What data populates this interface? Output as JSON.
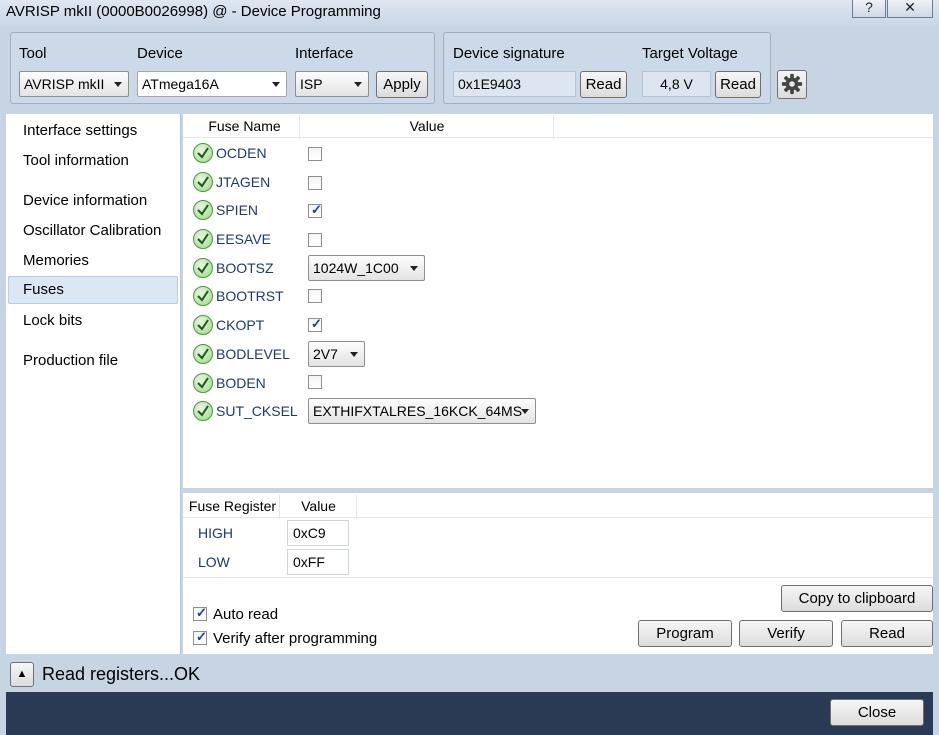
{
  "window": {
    "title": "AVRISP mkII (0000B0026998) @  - Device Programming",
    "help_label": "?",
    "close_label": "✕"
  },
  "toolbar": {
    "tool_label": "Tool",
    "tool_value": "AVRISP mkII",
    "device_label": "Device",
    "device_value": "ATmega16A",
    "interface_label": "Interface",
    "interface_value": "ISP",
    "apply_label": "Apply",
    "signature_label": "Device signature",
    "signature_value": "0x1E9403",
    "signature_read_label": "Read",
    "voltage_label": "Target Voltage",
    "voltage_value": "4,8 V",
    "voltage_read_label": "Read",
    "settings_icon": "gear-icon"
  },
  "sidebar": {
    "items": [
      {
        "label": "Interface settings"
      },
      {
        "label": "Tool information"
      },
      {
        "label": "Device information"
      },
      {
        "label": "Oscillator Calibration"
      },
      {
        "label": "Memories"
      },
      {
        "label": "Fuses"
      },
      {
        "label": "Lock bits"
      },
      {
        "label": "Production file"
      }
    ],
    "selected": "Fuses"
  },
  "fuses": {
    "col_name": "Fuse Name",
    "col_value": "Value",
    "rows": [
      {
        "name": "OCDEN",
        "checked": false
      },
      {
        "name": "JTAGEN",
        "checked": false
      },
      {
        "name": "SPIEN",
        "checked": true
      },
      {
        "name": "EESAVE",
        "checked": false
      },
      {
        "name": "BOOTSZ",
        "select": "1024W_1C00"
      },
      {
        "name": "BOOTRST",
        "checked": false
      },
      {
        "name": "CKOPT",
        "checked": true
      },
      {
        "name": "BODLEVEL",
        "select": "2V7"
      },
      {
        "name": "BODEN",
        "checked": false
      },
      {
        "name": "SUT_CKSEL",
        "select": "EXTHIFXTALRES_16KCK_64MS"
      }
    ]
  },
  "registers": {
    "col_name": "Fuse Register",
    "col_value": "Value",
    "rows": [
      {
        "name": "HIGH",
        "value": "0xC9"
      },
      {
        "name": "LOW",
        "value": "0xFF"
      }
    ]
  },
  "options": {
    "auto_read_label": "Auto read",
    "auto_read_checked": true,
    "verify_label": "Verify after programming",
    "verify_checked": true
  },
  "actions": {
    "copy_label": "Copy to clipboard",
    "program_label": "Program",
    "verify_label": "Verify",
    "read_label": "Read"
  },
  "status": {
    "text": "Read registers...OK",
    "expand_icon": "triangle-up-icon"
  },
  "footer": {
    "close_label": "Close"
  }
}
